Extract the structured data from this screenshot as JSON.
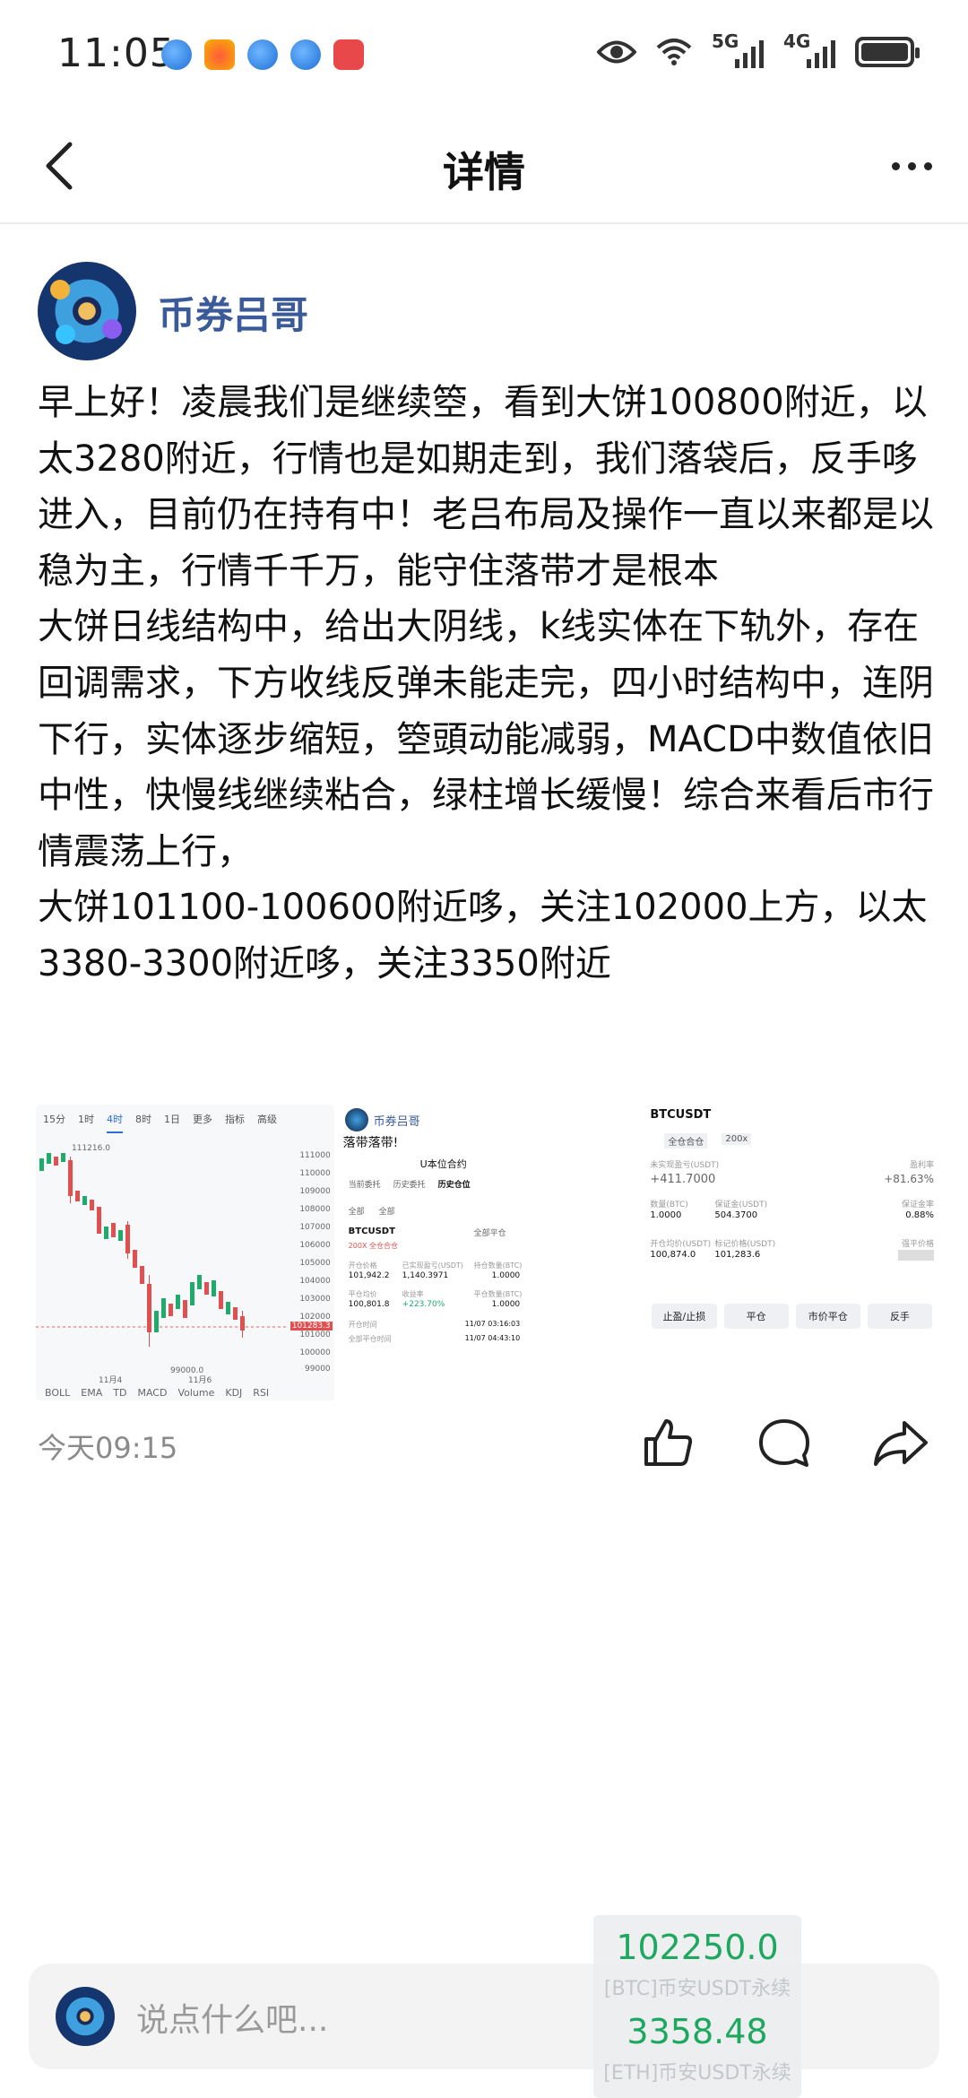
{
  "status_bar": {
    "time": "11:05",
    "net1": "5G",
    "net2": "4G"
  },
  "nav": {
    "title": "详情"
  },
  "post": {
    "author": "币券吕哥",
    "content": "早上好！凌晨我们是继续箜，看到大饼100800附近，以太3280附近，行情也是如期走到，我们落袋后，反手哆进入，目前仍在持有中！老吕布局及操作一直以来都是以稳为主，行情千千万，能守住落带才是根本\n大饼日线结构中，给出大阴线，k线实体在下轨外，存在回调需求，下方收线反弹未能走完，四小时结构中，连阴下行，实体逐步缩短，箜頭动能减弱，MACD中数值依旧中性，快慢线继续粘合，绿柱增长缓慢！综合来看后市行情震荡上行，\n大饼101100-100600附近哆，关注102000上方，以太3380-3300附近哆，关注3350附近",
    "time": "今天09:15"
  },
  "images": {
    "chart": {
      "tabs": [
        "15分",
        "1时",
        "4时",
        "8时",
        "1日",
        "更多",
        "指标",
        "高级"
      ],
      "active_tab": "4时",
      "high_label": "111216.0",
      "current_price": "101283.3",
      "low_label": "99000.0",
      "axis": [
        "111000",
        "110000",
        "109000",
        "108000",
        "107000",
        "106000",
        "105000",
        "104000",
        "103000",
        "102000",
        "101000",
        "100000",
        "99000"
      ],
      "date1": "11月4",
      "date2": "11月6",
      "indicators": [
        "BOLL",
        "EMA",
        "TD",
        "MACD",
        "Volume",
        "KDJ",
        "RSI"
      ]
    },
    "orders": {
      "author": "币券吕哥",
      "caption": "落带落带!",
      "header": "U本位合约",
      "tabs": [
        "当前委托",
        "历史委托",
        "历史仓位"
      ],
      "filters": [
        "全部",
        "全部"
      ],
      "symbol": "BTCUSDT",
      "status": "全部平仓",
      "leverage": "200X 全仓合仓",
      "row1_labels": [
        "开仓价格",
        "已实现盈亏(USDT)",
        "持仓数量(BTC)"
      ],
      "row1_values": [
        "101,942.2",
        "1,140.3971",
        "1.0000"
      ],
      "row2_labels": [
        "平仓均价",
        "收益率",
        "平仓数量(BTC)"
      ],
      "row2_values": [
        "100,801.8",
        "+223.70%",
        "1.0000"
      ],
      "open_time_label": "开仓时间",
      "open_time": "11/07 03:16:03",
      "close_time_label": "全部平仓时间",
      "close_time": "11/07 04:43:10"
    },
    "position": {
      "symbol": "BTCUSDT",
      "mode": "全仓合仓",
      "leverage": "200x",
      "pnl_label": "未实现盈亏(USDT)",
      "pnl": "+411.7000",
      "roi_label": "盈利率",
      "roi": "+81.63%",
      "size_label": "数量(BTC)",
      "size": "1.0000",
      "margin_label": "保证金(USDT)",
      "margin": "504.3700",
      "ratio_label": "保证金率",
      "ratio": "0.88%",
      "entry_label": "开仓均价(USDT)",
      "entry": "100,874.0",
      "mark_label": "标记价格(USDT)",
      "mark": "101,283.6",
      "liq_label": "强平价格",
      "buttons": [
        "止盈/止损",
        "平仓",
        "市价平仓",
        "反手"
      ]
    }
  },
  "comment": {
    "placeholder": "说点什么吧..."
  },
  "ticker": {
    "btc_price": "102250.0",
    "btc_label": "[BTC]币安USDT永续",
    "eth_price": "3358.48",
    "eth_label": "[ETH]币安USDT永续"
  },
  "colors": {
    "author": "#3a5a99",
    "profit": "#1fab6b",
    "tab_active": "#2b6cd6"
  }
}
